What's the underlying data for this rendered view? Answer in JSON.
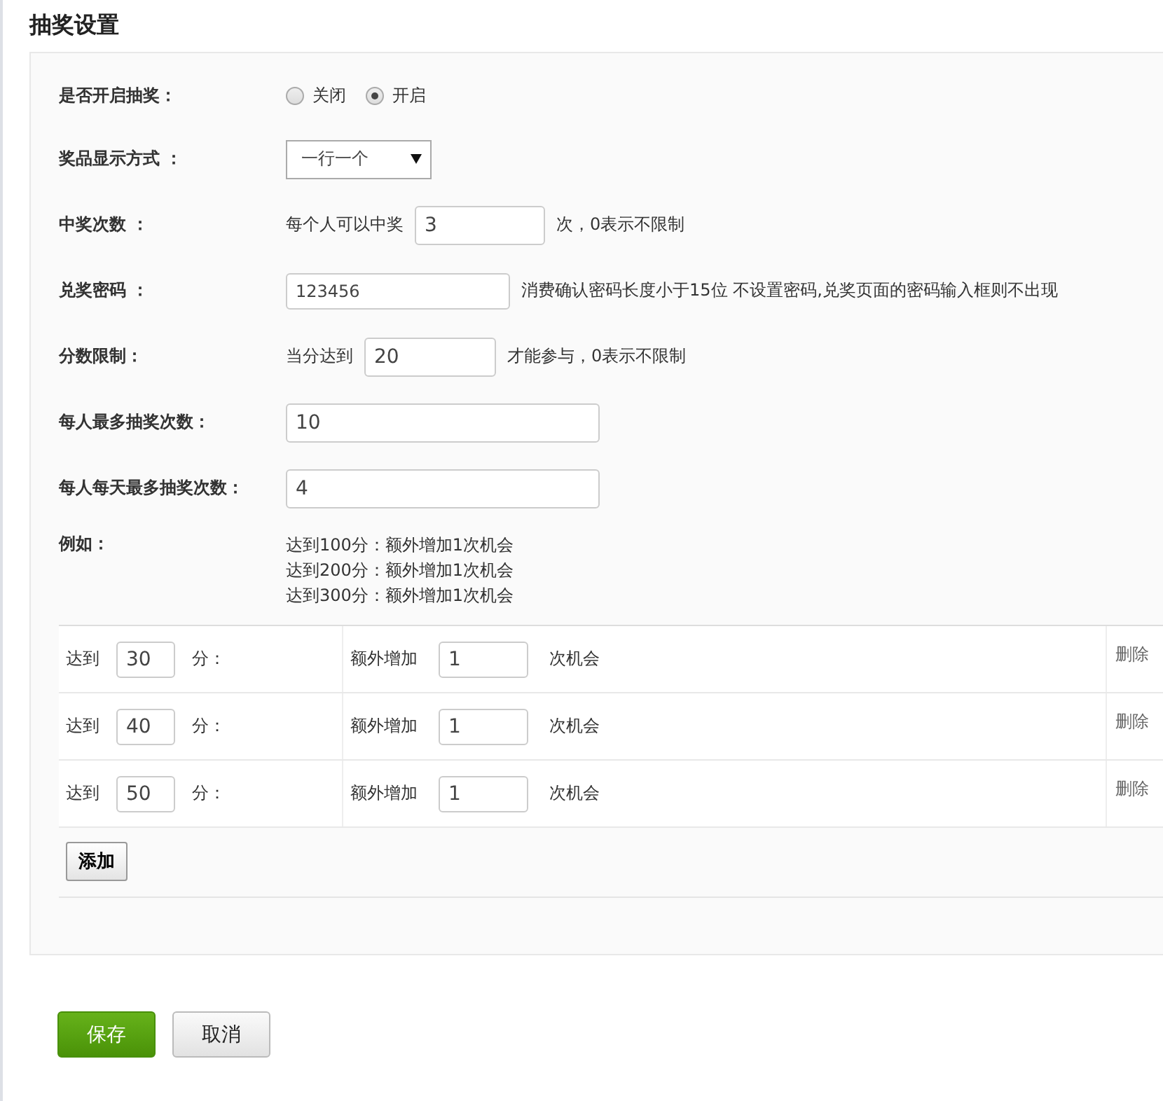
{
  "title": "抽奖设置",
  "fields": [
    {
      "kind": "radio",
      "label": "是否开启抽奖：",
      "options": [
        {
          "label": "关闭",
          "selected": false
        },
        {
          "label": "开启",
          "selected": true
        }
      ]
    },
    {
      "kind": "select",
      "label": "奖品显示方式 ：",
      "value": "一行一个"
    },
    {
      "kind": "input",
      "label": "中奖次数 ：",
      "prefix": "每个人可以中奖",
      "value": "3",
      "suffix": "次，0表示不限制"
    },
    {
      "kind": "input",
      "label": "兑奖密码 ：",
      "value": "123456",
      "suffix": "消费确认密码长度小于15位 不设置密码,兑奖页面的密码输入框则不出现"
    },
    {
      "kind": "input",
      "label": "分数限制：",
      "prefix": "当分达到",
      "value": "20",
      "suffix": "才能参与，0表示不限制"
    },
    {
      "kind": "input",
      "label": "每人最多抽奖次数：",
      "value": "10"
    },
    {
      "kind": "input",
      "label": "每人每天最多抽奖次数：",
      "value": "4"
    },
    {
      "kind": "example",
      "label": "例如：",
      "lines": [
        "达到100分：额外增加1次机会",
        "达到200分：额外增加1次机会",
        "达到300分：额外增加1次机会"
      ]
    }
  ],
  "rules": [
    {
      "prefix": "达到",
      "score": "30",
      "unit": "分：",
      "extra_label": "额外增加",
      "extra": "1",
      "suffix": "次机会",
      "action": "删除"
    },
    {
      "prefix": "达到",
      "score": "40",
      "unit": "分：",
      "extra_label": "额外增加",
      "extra": "1",
      "suffix": "次机会",
      "action": "删除"
    },
    {
      "prefix": "达到",
      "score": "50",
      "unit": "分：",
      "extra_label": "额外增加",
      "extra": "1",
      "suffix": "次机会",
      "action": "删除"
    }
  ],
  "add_button": "添加",
  "buttons": [
    {
      "kind": "primary",
      "label": "保存"
    },
    {
      "kind": "default",
      "label": "取消"
    }
  ]
}
